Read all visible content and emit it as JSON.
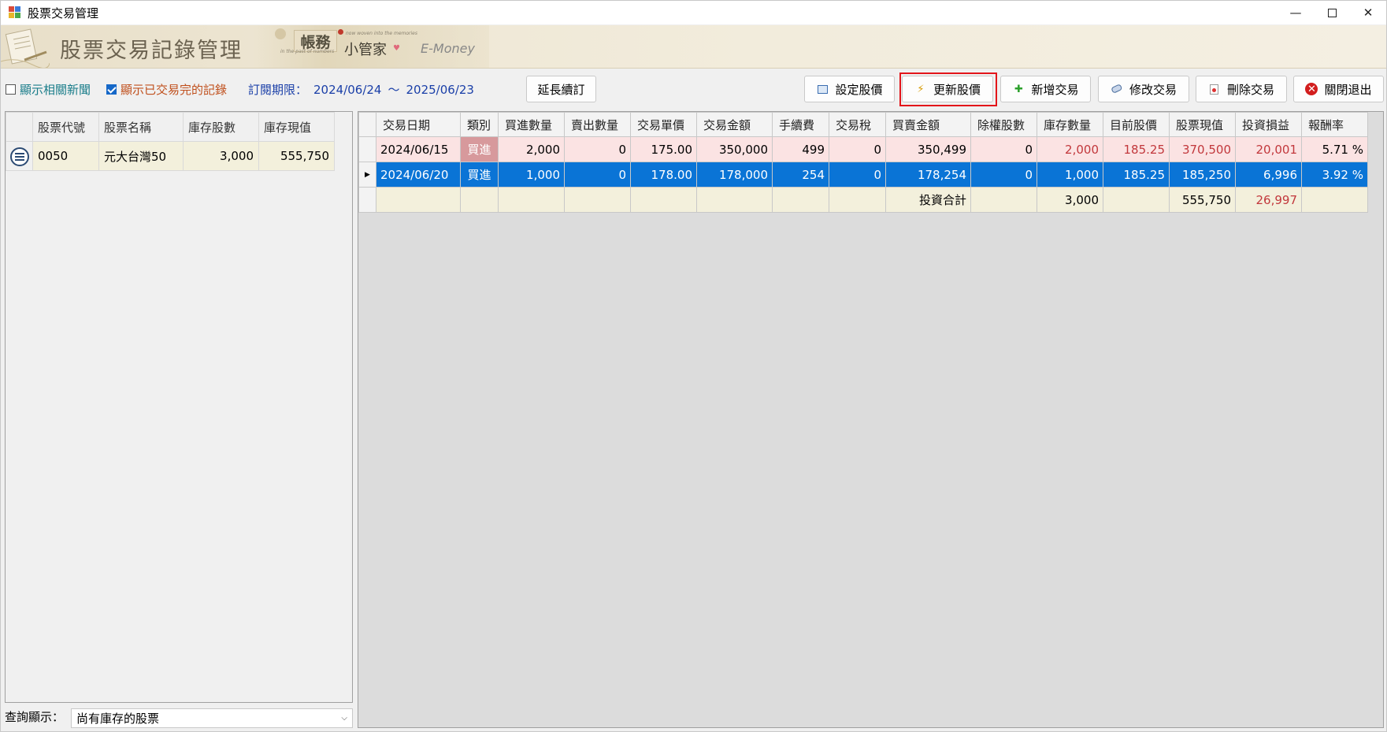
{
  "window": {
    "title": "股票交易管理"
  },
  "banner": {
    "title": "股票交易記錄管理",
    "brand_zhang": "帳務",
    "brand_name": "小管家",
    "brand_tagline": "now woven into the memories",
    "brand_tagline2": "in the past of numbers",
    "brand_en": "E-Money"
  },
  "toolbar": {
    "show_news_label": "顯示相關新聞",
    "show_news_checked": false,
    "show_done_label": "顯示已交易完的記錄",
    "show_done_checked": true,
    "subscription_label": "訂閱期限：",
    "subscription_start": "2024/06/24",
    "subscription_sep": "～",
    "subscription_end": "2025/06/23",
    "extend_label": "延長續訂",
    "set_price_label": "設定股價",
    "update_price_label": "更新股價",
    "add_trade_label": "新增交易",
    "edit_trade_label": "修改交易",
    "delete_trade_label": "刪除交易",
    "exit_label": "關閉退出"
  },
  "stocks": {
    "columns": [
      "股票代號",
      "股票名稱",
      "庫存股數",
      "庫存現值"
    ],
    "rows": [
      {
        "code": "0050",
        "name": "元大台灣50",
        "shares": "3,000",
        "value": "555,750"
      }
    ]
  },
  "query": {
    "label": "查詢顯示：",
    "selected": "尚有庫存的股票"
  },
  "trades": {
    "columns": [
      "交易日期",
      "類別",
      "買進數量",
      "賣出數量",
      "交易單價",
      "交易金額",
      "手續費",
      "交易稅",
      "買賣金額",
      "除權股數",
      "庫存數量",
      "目前股價",
      "股票現值",
      "投資損益",
      "報酬率"
    ],
    "rows": [
      {
        "date": "2024/06/15",
        "type": "買進",
        "buy_qty": "2,000",
        "sell_qty": "0",
        "unit_price": "175.00",
        "amount": "350,000",
        "fee": "499",
        "tax": "0",
        "trade_amount": "350,499",
        "rights": "0",
        "stock_qty": "2,000",
        "cur_price": "185.25",
        "cur_value": "370,500",
        "profit": "20,001",
        "return": "5.71 %"
      },
      {
        "date": "2024/06/20",
        "type": "買進",
        "buy_qty": "1,000",
        "sell_qty": "0",
        "unit_price": "178.00",
        "amount": "178,000",
        "fee": "254",
        "tax": "0",
        "trade_amount": "178,254",
        "rights": "0",
        "stock_qty": "1,000",
        "cur_price": "185.25",
        "cur_value": "185,250",
        "profit": "6,996",
        "return": "3.92 %"
      }
    ],
    "total": {
      "label": "投資合計",
      "stock_qty": "3,000",
      "cur_value": "555,750",
      "profit": "26,997"
    }
  },
  "colors": {
    "accent_blue": "#0a74d6",
    "profit_red": "#c2383c",
    "highlight_border": "#e3151a"
  }
}
